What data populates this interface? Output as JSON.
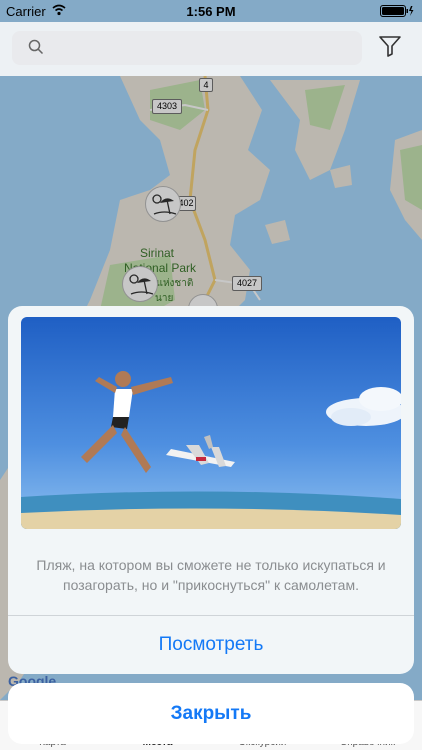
{
  "status_bar": {
    "carrier": "Carrier",
    "time": "1:56 PM"
  },
  "search": {
    "placeholder": ""
  },
  "map": {
    "road_labels": [
      "4",
      "4303",
      "402",
      "4027"
    ],
    "park_name_line1": "Sirinat",
    "park_name_line2": "National Park",
    "park_name_thai": "ุดแห่งชาติ",
    "thai_fragment": "นาย",
    "google": "Google",
    "land_color": "#f0ebe0",
    "water_color": "#aadaff",
    "park_color": "#c8e6b4"
  },
  "card": {
    "description": "Пляж, на котором вы сможете не только искупаться и позагорать, но и \"прикоснуться\" к самолетам.",
    "view_label": "Посмотреть"
  },
  "close_label": "Закрыть",
  "tabs": [
    "Карта",
    "Места",
    "Экскурсии",
    "Справочник"
  ],
  "colors": {
    "accent": "#1479f6"
  }
}
